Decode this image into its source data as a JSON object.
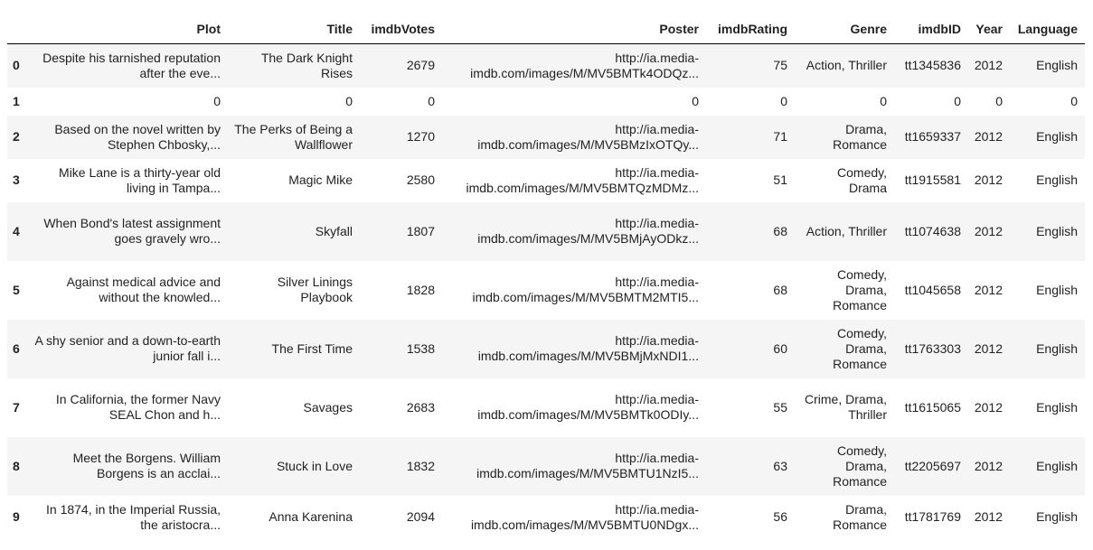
{
  "dataframe": {
    "columns": [
      "",
      "Plot",
      "Title",
      "imdbVotes",
      "Poster",
      "imdbRating",
      "Genre",
      "imdbID",
      "Year",
      "Language"
    ],
    "rows": [
      {
        "index": "0",
        "Plot": "Despite his tarnished reputation after the eve...",
        "Title": "The Dark Knight Rises",
        "imdbVotes": "2679",
        "Poster": "http://ia.media-imdb.com/images/M/MV5BMTk4ODQz...",
        "imdbRating": "75",
        "Genre": "Action, Thriller",
        "imdbID": "tt1345836",
        "Year": "2012",
        "Language": "English"
      },
      {
        "index": "1",
        "Plot": "0",
        "Title": "0",
        "imdbVotes": "0",
        "Poster": "0",
        "imdbRating": "0",
        "Genre": "0",
        "imdbID": "0",
        "Year": "0",
        "Language": "0"
      },
      {
        "index": "2",
        "Plot": "Based on the novel written by Stephen Chbosky,...",
        "Title": "The Perks of Being a Wallflower",
        "imdbVotes": "1270",
        "Poster": "http://ia.media-imdb.com/images/M/MV5BMzIxOTQy...",
        "imdbRating": "71",
        "Genre": "Drama, Romance",
        "imdbID": "tt1659337",
        "Year": "2012",
        "Language": "English"
      },
      {
        "index": "3",
        "Plot": "Mike Lane is a thirty-year old living in Tampa...",
        "Title": "Magic Mike",
        "imdbVotes": "2580",
        "Poster": "http://ia.media-imdb.com/images/M/MV5BMTQzMDMz...",
        "imdbRating": "51",
        "Genre": "Comedy, Drama",
        "imdbID": "tt1915581",
        "Year": "2012",
        "Language": "English"
      },
      {
        "index": "4",
        "Plot": "When Bond's latest assignment goes gravely wro...",
        "Title": "Skyfall",
        "imdbVotes": "1807",
        "Poster": "http://ia.media-imdb.com/images/M/MV5BMjAyODkz...",
        "imdbRating": "68",
        "Genre": "Action, Thriller",
        "imdbID": "tt1074638",
        "Year": "2012",
        "Language": "English"
      },
      {
        "index": "5",
        "Plot": "Against medical advice and without the knowled...",
        "Title": "Silver Linings Playbook",
        "imdbVotes": "1828",
        "Poster": "http://ia.media-imdb.com/images/M/MV5BMTM2MTI5...",
        "imdbRating": "68",
        "Genre": "Comedy, Drama, Romance",
        "imdbID": "tt1045658",
        "Year": "2012",
        "Language": "English"
      },
      {
        "index": "6",
        "Plot": "A shy senior and a down-to-earth junior fall i...",
        "Title": "The First Time",
        "imdbVotes": "1538",
        "Poster": "http://ia.media-imdb.com/images/M/MV5BMjMxNDI1...",
        "imdbRating": "60",
        "Genre": "Comedy, Drama, Romance",
        "imdbID": "tt1763303",
        "Year": "2012",
        "Language": "English"
      },
      {
        "index": "7",
        "Plot": "In California, the former Navy SEAL Chon and h...",
        "Title": "Savages",
        "imdbVotes": "2683",
        "Poster": "http://ia.media-imdb.com/images/M/MV5BMTk0ODIy...",
        "imdbRating": "55",
        "Genre": "Crime, Drama, Thriller",
        "imdbID": "tt1615065",
        "Year": "2012",
        "Language": "English"
      },
      {
        "index": "8",
        "Plot": "Meet the Borgens. William Borgens is an acclai...",
        "Title": "Stuck in Love",
        "imdbVotes": "1832",
        "Poster": "http://ia.media-imdb.com/images/M/MV5BMTU1NzI5...",
        "imdbRating": "63",
        "Genre": "Comedy, Drama, Romance",
        "imdbID": "tt2205697",
        "Year": "2012",
        "Language": "English"
      },
      {
        "index": "9",
        "Plot": "In 1874, in the Imperial Russia, the aristocra...",
        "Title": "Anna Karenina",
        "imdbVotes": "2094",
        "Poster": "http://ia.media-imdb.com/images/M/MV5BMTU0NDgx...",
        "imdbRating": "56",
        "Genre": "Drama, Romance",
        "imdbID": "tt1781769",
        "Year": "2012",
        "Language": "English"
      }
    ]
  }
}
